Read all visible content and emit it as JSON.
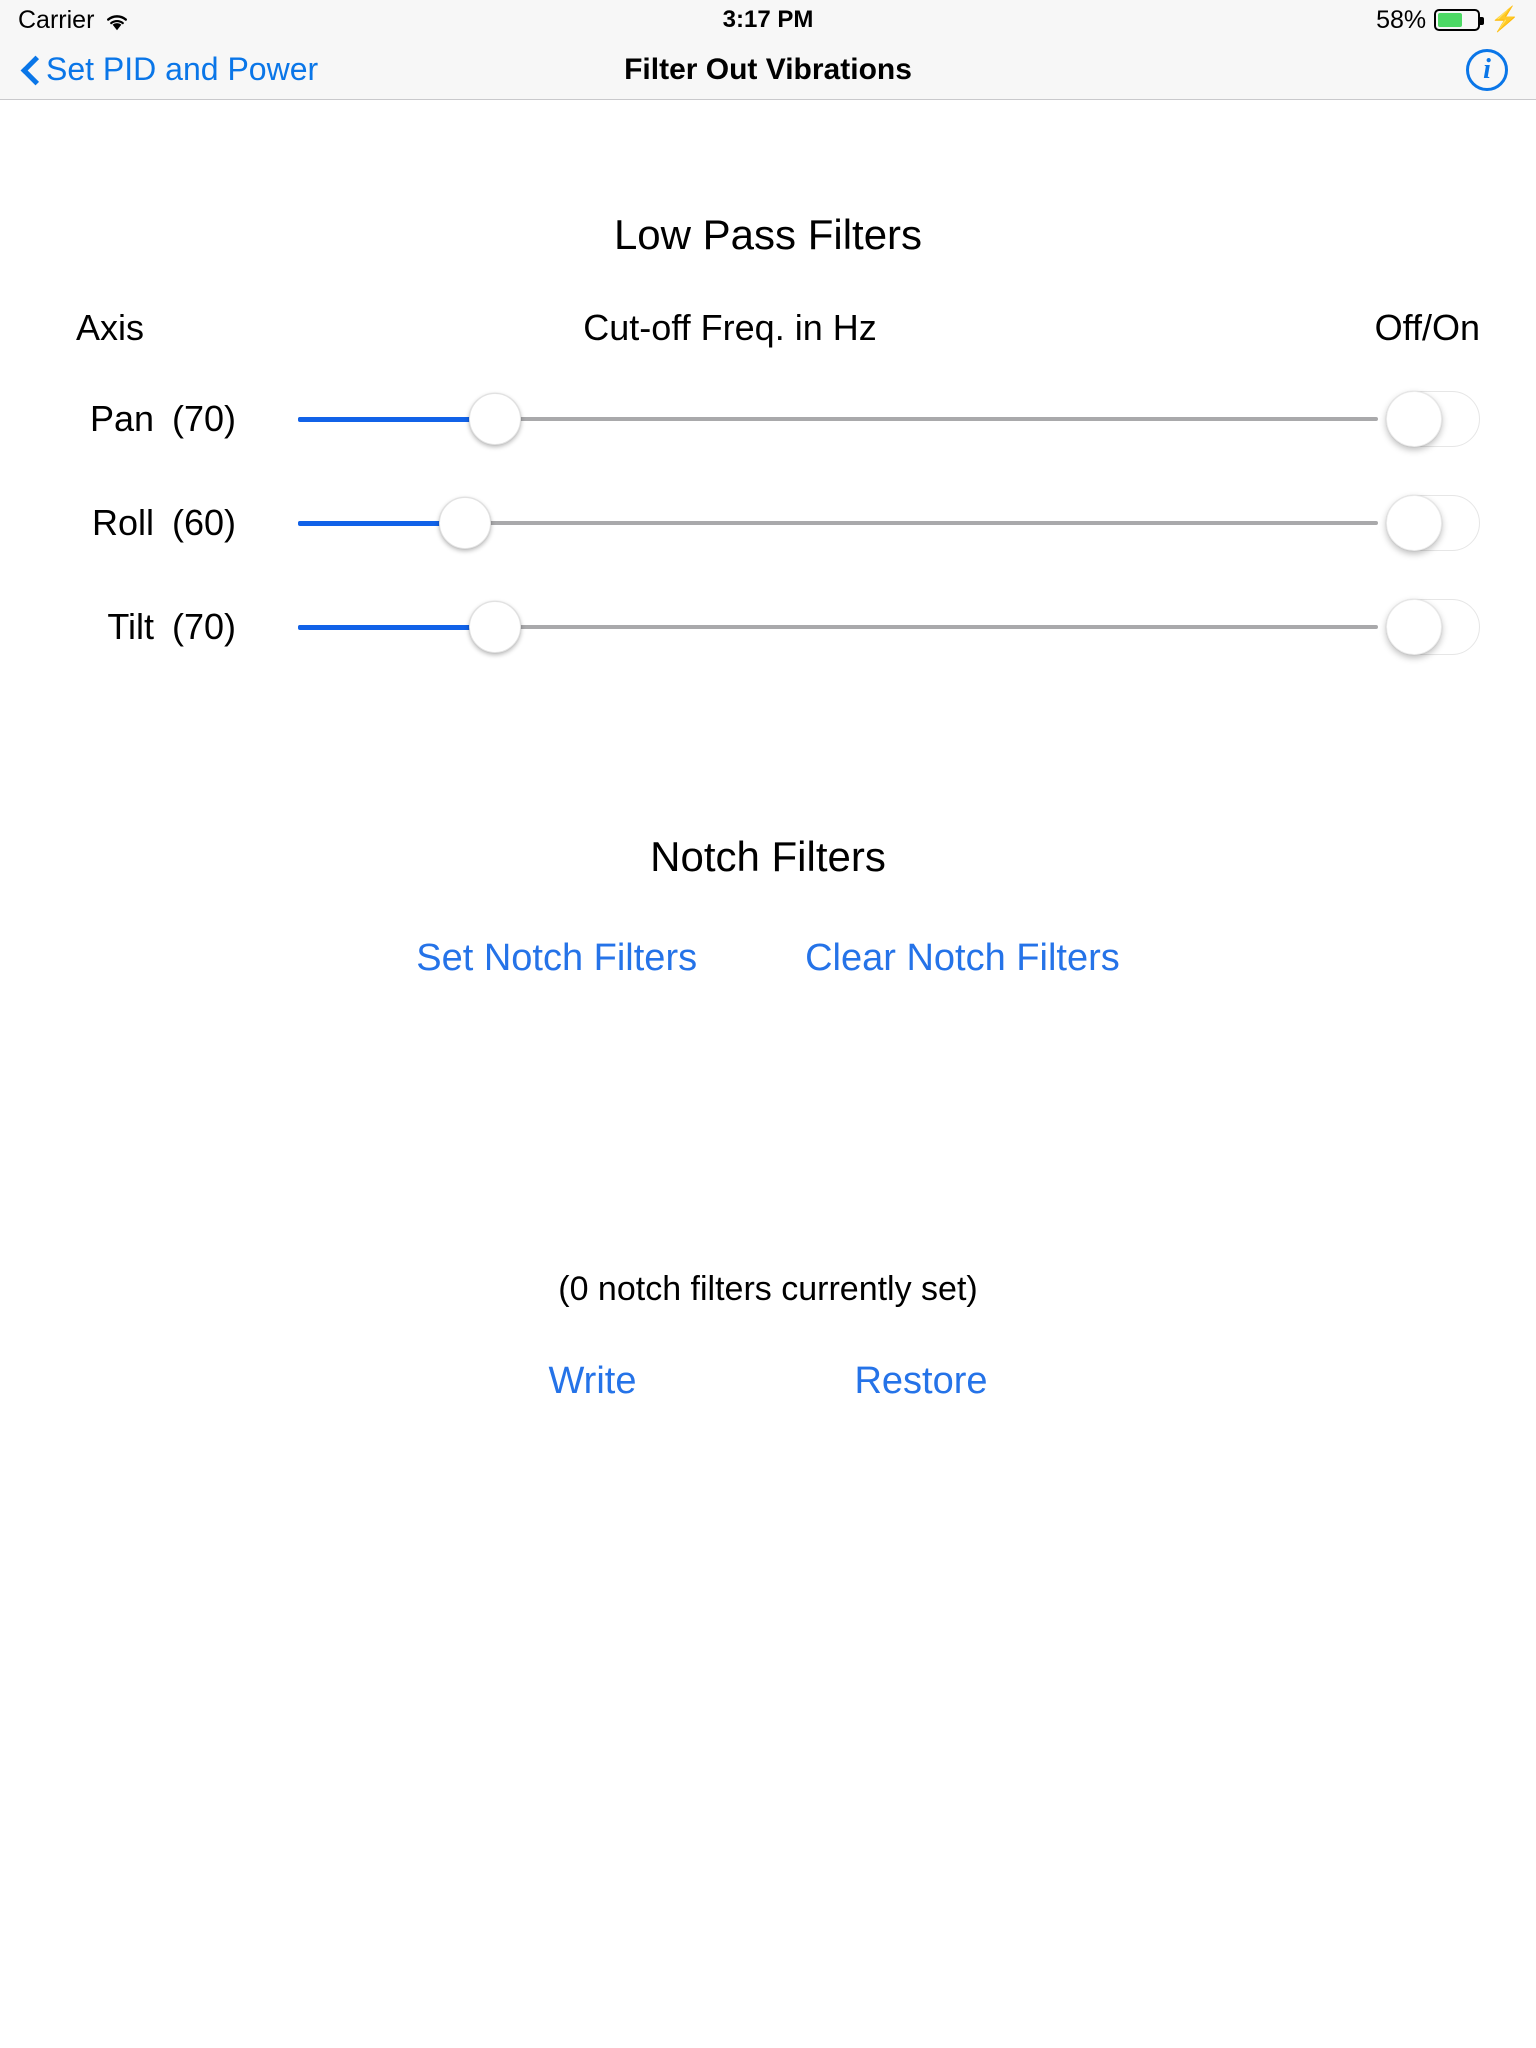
{
  "status_bar": {
    "carrier": "Carrier",
    "wifi_icon": "wifi-icon",
    "time": "3:17 PM",
    "battery_percent": "58%",
    "battery_level": 58,
    "battery_color": "#4cd964",
    "charging_icon": "⚡"
  },
  "nav_bar": {
    "back_label": "Set PID and Power",
    "back_icon": "chevron-left-icon",
    "title": "Filter Out Vibrations",
    "info_icon": "info-circle-icon",
    "info_letter": "i",
    "accent_color": "#0a76e8"
  },
  "low_pass": {
    "title": "Low Pass Filters",
    "headers": {
      "axis": "Axis",
      "cutoff": "Cut-off Freq. in Hz",
      "offon": "Off/On"
    },
    "rows": [
      {
        "axis": "Pan",
        "value": "(70)",
        "number": 70,
        "percent": 18.2,
        "enabled": false,
        "toggle_state": "off"
      },
      {
        "axis": "Roll",
        "value": "(60)",
        "number": 60,
        "percent": 15.5,
        "enabled": false,
        "toggle_state": "off"
      },
      {
        "axis": "Tilt",
        "value": "(70)",
        "number": 70,
        "percent": 18.2,
        "enabled": false,
        "toggle_state": "off"
      }
    ],
    "fill_color": "#1162e8",
    "track_color": "#a9a9ab"
  },
  "notch": {
    "title": "Notch Filters",
    "set_label": "Set Notch Filters",
    "clear_label": "Clear Notch Filters",
    "status_text": "(0 notch filters currently set)",
    "count": 0
  },
  "footer": {
    "write_label": "Write",
    "restore_label": "Restore",
    "link_color": "#2573e8"
  }
}
